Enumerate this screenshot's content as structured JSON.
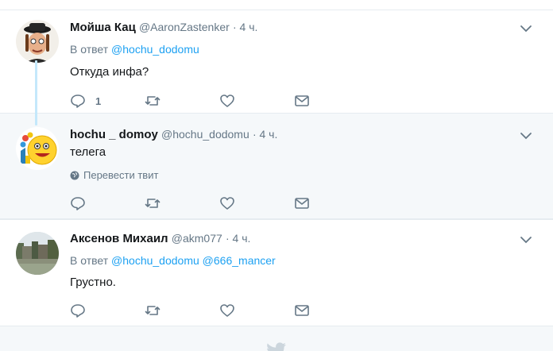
{
  "tweets": [
    {
      "name": "Мойша Кац",
      "handle": "@AaronZastenker",
      "time": "· 4 ч.",
      "reply_prefix": "В ответ",
      "reply_mentions": [
        "@hochu_dodomu"
      ],
      "text": "Откуда инфа?",
      "reply_count": "1"
    },
    {
      "name": "hochu _ domoy",
      "handle": "@hochu_dodomu",
      "time": "· 4 ч.",
      "text": "телега",
      "translate": "Перевести твит"
    },
    {
      "name": "Аксенов Михаил",
      "handle": "@akm077",
      "time": "· 4 ч.",
      "reply_prefix": "В ответ",
      "reply_mentions": [
        "@hochu_dodomu",
        "@666_mancer"
      ],
      "text": "Грустно."
    }
  ],
  "icons": {
    "reply": "reply-icon",
    "retweet": "retweet-icon",
    "like": "heart-icon",
    "dm": "envelope-icon",
    "more": "chevron-down-icon",
    "globe": "globe-icon",
    "bird": "twitter-bird-icon"
  },
  "colors": {
    "link": "#1da1f2",
    "secondary": "#657786",
    "thread_line": "#c4e8fb",
    "highlight_bg": "#f5f8fa"
  }
}
